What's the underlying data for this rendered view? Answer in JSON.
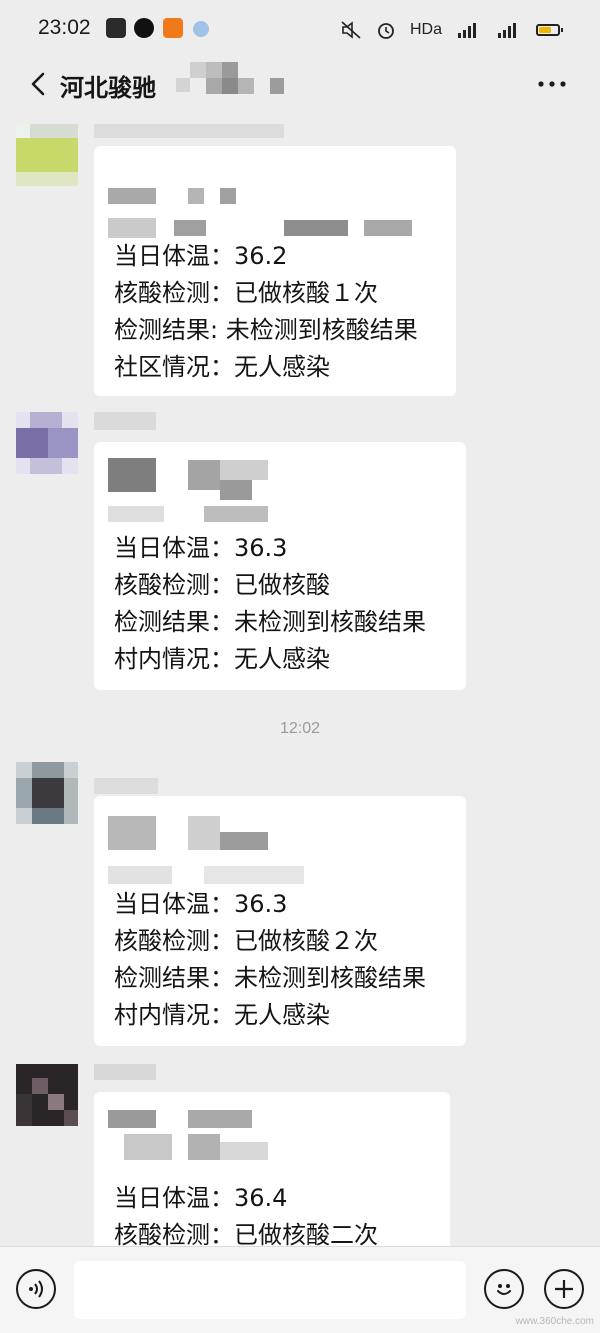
{
  "status_bar": {
    "time": "23:02",
    "network_label": "HDa",
    "icons": [
      "app-icon-1",
      "app-icon-2",
      "app-icon-3",
      "app-icon-4",
      "mute-icon",
      "alarm-icon",
      "wifi-signal-icon",
      "cell-signal-icon",
      "battery-icon"
    ],
    "battery_color": "#f2b600"
  },
  "header": {
    "title": "河北骏驰",
    "back_icon": "back-chevron-icon",
    "more_icon": "more-dots-icon"
  },
  "messages": [
    {
      "avatar_color": "#c8d96a",
      "lines": [
        "当日体温：36.2",
        "核酸检测：已做核酸１次",
        "检测结果: 未检测到核酸结果",
        "社区情况：无人感染"
      ]
    },
    {
      "avatar_color": "#8b7fb8",
      "lines": [
        "当日体温：36.3",
        "核酸检测：已做核酸",
        "检测结果：未检测到核酸结果",
        "村内情况：无人感染"
      ]
    },
    {
      "avatar_color": "#6b7a82",
      "lines": [
        "当日体温：36.3",
        "核酸检测：已做核酸２次",
        "检测结果：未检测到核酸结果",
        "村内情况：无人感染"
      ]
    },
    {
      "avatar_color": "#3a3436",
      "lines": [
        "当日体温：36.4",
        "核酸检测：已做核酸二次"
      ]
    }
  ],
  "timestamp": "12:02",
  "input_bar": {
    "voice_icon": "voice-icon",
    "emoji_icon": "emoji-icon",
    "plus_icon": "plus-icon",
    "input_value": ""
  },
  "watermark": "www.360che.com"
}
